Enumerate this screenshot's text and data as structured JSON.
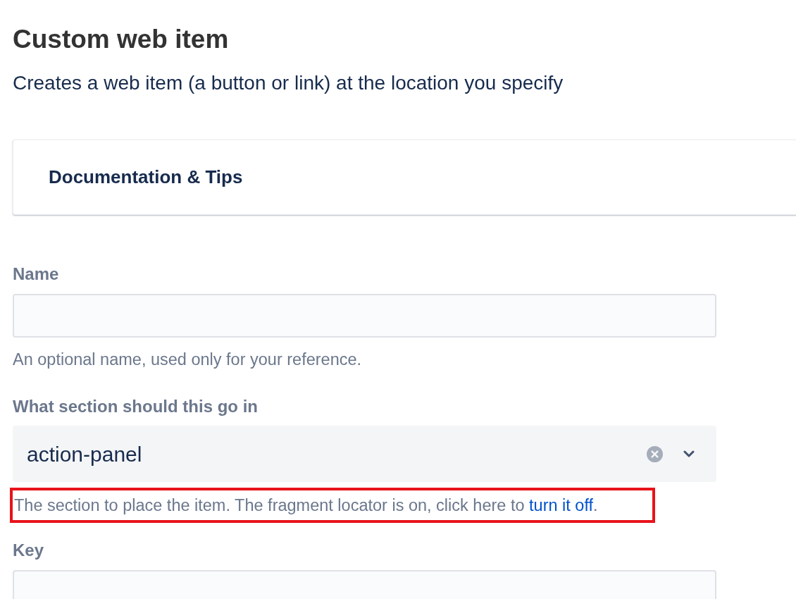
{
  "page": {
    "title": "Custom web item",
    "description": "Creates a web item (a button or link) at the location you specify"
  },
  "panel": {
    "title": "Documentation & Tips"
  },
  "fields": [
    {
      "kind": "text",
      "label": "Name",
      "hint": {
        "parts": [
          {
            "kind": "text",
            "text": "An optional name, used only for your reference."
          }
        ]
      }
    },
    {
      "kind": "select",
      "label": "What section should this go in",
      "value": "action-panel",
      "clearable": true,
      "hint": {
        "parts": [
          {
            "kind": "text",
            "text": "The section to place the item. The fragment locator is on, click here to "
          },
          {
            "kind": "link",
            "text": "turn it off"
          },
          {
            "kind": "text",
            "text": "."
          }
        ],
        "highlighted": true
      }
    },
    {
      "kind": "text",
      "label": "Key"
    }
  ]
}
